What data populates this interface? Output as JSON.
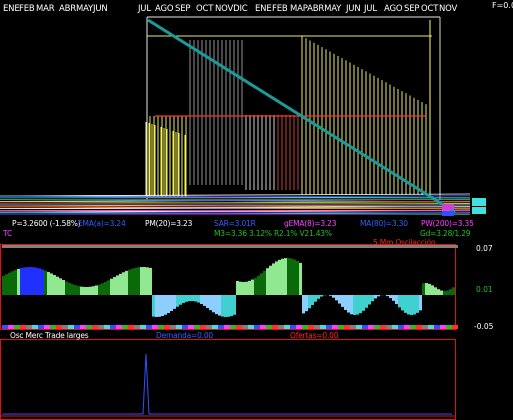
{
  "colors": {
    "background": "#000000",
    "panel_border": "#e01010",
    "trend_line": "#1b9a9a",
    "text_white": "#ffffff",
    "text_red": "#ff2020",
    "text_blue": "#3060ff",
    "text_green": "#20c020",
    "text_magenta": "#ff40ff",
    "text_yellow": "#ffff40",
    "osc_dark_green": "#0a6a0a",
    "osc_light_green": "#90e890",
    "osc_cyan": "#40d0d0",
    "osc_light_blue": "#8ccfff"
  },
  "price_panel": {
    "top_right_label": "F=0.0",
    "months": [
      "ENE",
      "FEB",
      "MAR",
      "ABRMAYJUN",
      "JUL",
      "AGO",
      "SEP",
      "OCT",
      "NOVDIC",
      "ENE",
      "FEB",
      "MAPABRMAY",
      "JUN",
      "JUL",
      "AGO",
      "SEP",
      "OCT",
      "NOV"
    ],
    "stats": {
      "price": "P=3.2600 (-1.58%)",
      "ema": "EMA(a)=3.24",
      "pm": "PM(20)=3.23",
      "sar": "SAR=3.01R",
      "gema": "gEMA(8)=3.23",
      "ma": "MA(80)=3.30",
      "pw": "PW(200)=3.35",
      "tc": "TC",
      "m3": "M3=3.36 3.12% R2.1% V21.43%",
      "gd": "Gd=3.28/1.29"
    }
  },
  "oscillator_panel": {
    "title": "5 Mm Oscilacción",
    "y_ticks": [
      "0.07",
      "0.01",
      "-0.05"
    ]
  },
  "volume_panel": {
    "title": "Osc Merc Trade larges",
    "demanda": "Demanda=0.00",
    "ofertas": "Ofertas=0.00"
  }
}
